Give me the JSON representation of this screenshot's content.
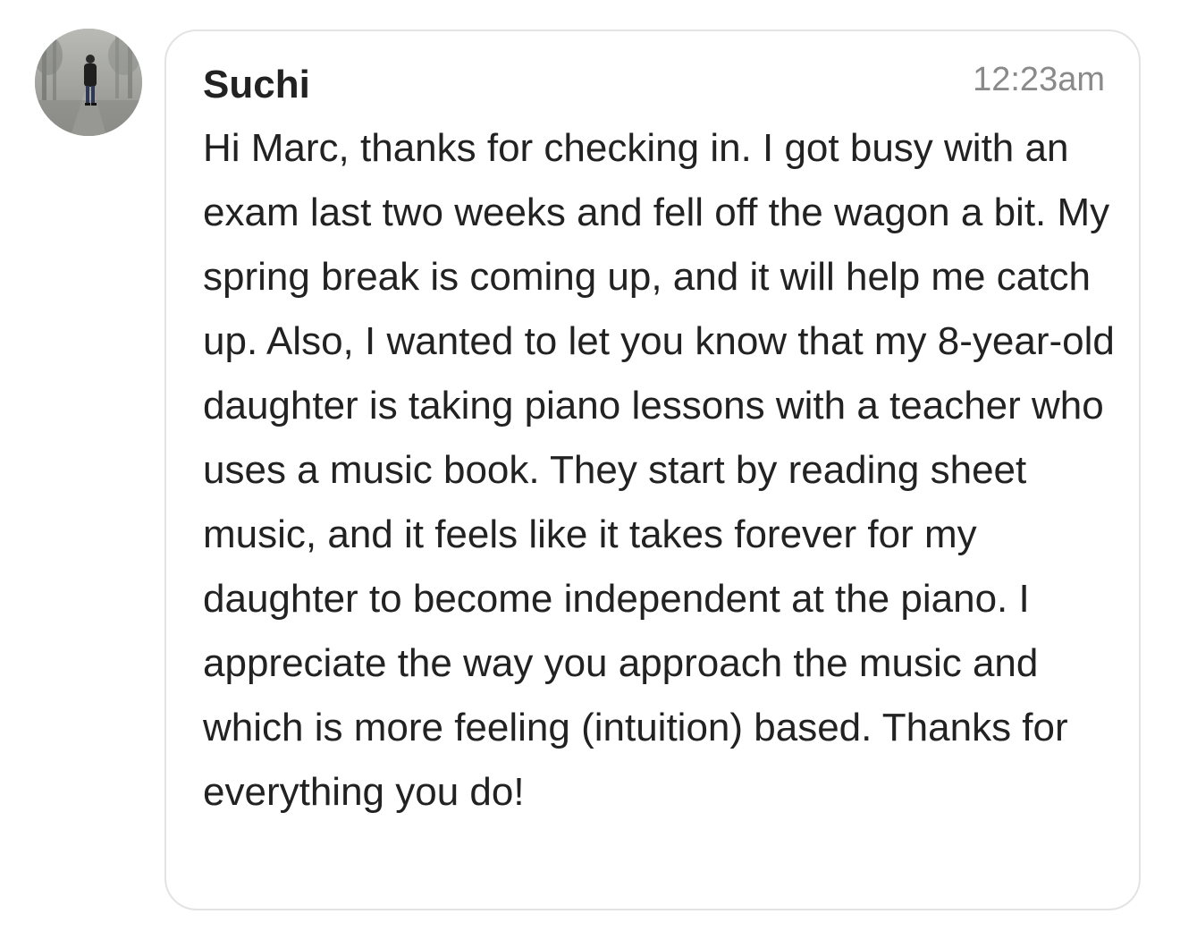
{
  "message": {
    "sender": "Suchi",
    "time": "12:23am",
    "text": "Hi Marc, thanks for checking in. I got busy with an exam last two weeks and fell off the wagon a bit. My spring break is coming up, and it will help me catch up. Also, I wanted to let you know that my 8-year-old daughter is taking piano lessons with a teacher who uses a music book. They start by reading sheet music, and it feels like it takes forever for my daughter to become independent at the piano. I appreciate the way you approach the music and which is more feeling (intuition) based. Thanks for everything you do!",
    "avatar_icon": "profile-photo"
  },
  "colors": {
    "bubble_border": "#e3e3e3",
    "text": "#222222",
    "timestamp": "#8a8a8a"
  }
}
